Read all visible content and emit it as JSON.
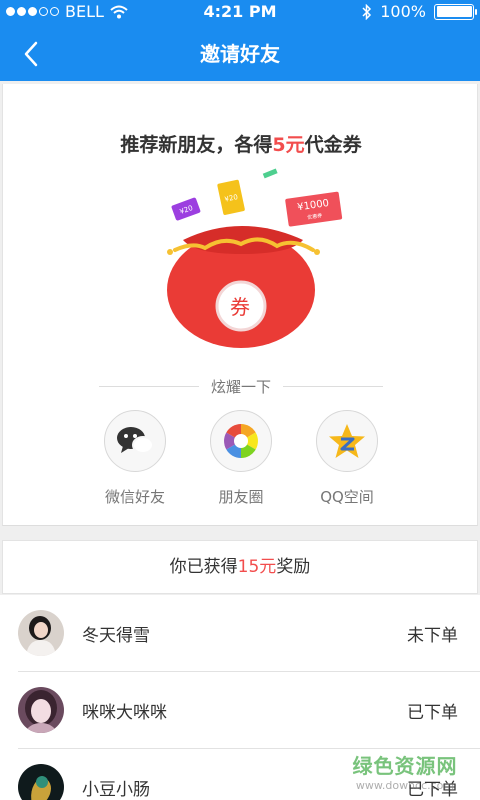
{
  "status_bar": {
    "carrier": "BELL",
    "time": "4:21 PM",
    "battery": "100%"
  },
  "nav": {
    "title": "邀请好友",
    "back_icon": "chevron-left-icon"
  },
  "invite": {
    "headline_prefix": "推荐新朋友，各得",
    "headline_amount": "5元",
    "headline_suffix": "代金券",
    "coupon_small": "¥20",
    "coupon_mid": "¥20",
    "coupon_big": "¥1000",
    "coupon_big_note": "优惠券",
    "bag_label": "券",
    "share_title": "炫耀一下",
    "share_items": [
      {
        "label": "微信好友",
        "icon": "wechat-icon"
      },
      {
        "label": "朋友圈",
        "icon": "moments-icon"
      },
      {
        "label": "QQ空间",
        "icon": "qzone-icon"
      }
    ]
  },
  "reward": {
    "prefix": "你已获得",
    "amount": "15元",
    "suffix": "奖励"
  },
  "friends": [
    {
      "name": "冬天得雪",
      "status": "未下单"
    },
    {
      "name": "咪咪大咪咪",
      "status": "已下单"
    },
    {
      "name": "小豆小肠",
      "status": "已下单"
    }
  ],
  "watermark": {
    "text": "绿色资源网",
    "url": "www.downcc.com"
  },
  "colors": {
    "primary": "#1a8cf0",
    "accent_red": "#f24d4d",
    "bag_red": "#ea3b36"
  }
}
